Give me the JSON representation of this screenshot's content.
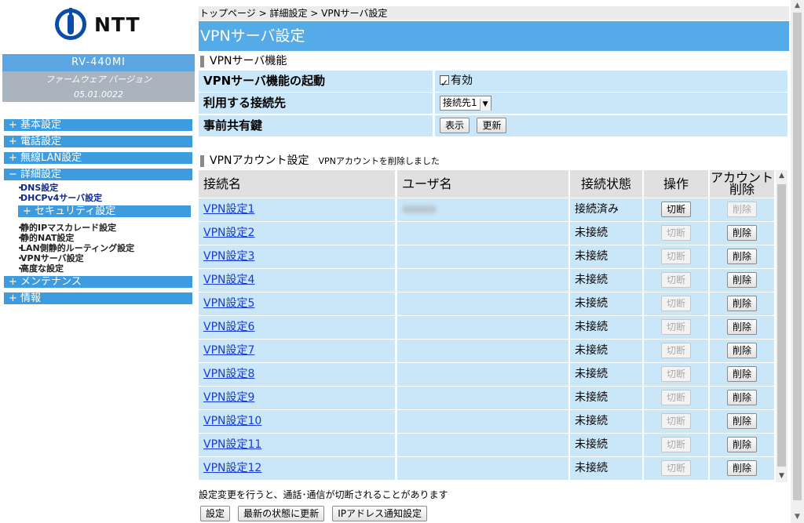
{
  "brand": {
    "logo_text": "NTT",
    "logo_icon": "ntt-logo-icon",
    "color": "#0a4da8"
  },
  "device": {
    "model": "RV-440MI",
    "firmware_label": "ファームウェア バージョン",
    "firmware_version": "05.01.0022"
  },
  "menu": {
    "basic": "+ 基本設定",
    "phone": "+ 電話設定",
    "wlan": "+ 無線LAN設定",
    "advanced": "− 詳細設定",
    "advanced_items": {
      "dns": "DNS設定",
      "dhcp": "DHCPv4サーバ設定",
      "security": "+ セキュリティ設定",
      "ipmasq": "静的IPマスカレード設定",
      "nat": "静的NAT設定",
      "routing": "LAN側静的ルーティング設定",
      "vpn": "VPNサーバ設定",
      "adv": "高度な設定"
    },
    "maintenance": "+ メンテナンス",
    "info": "+ 情報"
  },
  "breadcrumb": "トップページ > 詳細設定 > VPNサーバ設定",
  "page_title": "VPNサーバ設定",
  "vpn_server": {
    "heading": "VPNサーバ機能",
    "enable_label": "VPNサーバ機能の起動",
    "enable_value": "有効",
    "connection_label": "利用する接続先",
    "connection_value": "接続先1",
    "psk_label": "事前共有鍵",
    "show_button": "表示",
    "update_button": "更新"
  },
  "vpn_accounts": {
    "heading": "VPNアカウント設定",
    "message": "VPNアカウントを削除しました",
    "columns": {
      "name": "接続名",
      "user": "ユーザ名",
      "status": "接続状態",
      "action": "操作",
      "account_line1": "アカウント",
      "account_line2": "削除"
    },
    "disconnect_label": "切断",
    "delete_label": "削除",
    "rows": [
      {
        "name": "VPN設定1",
        "status": "接続済み"
      },
      {
        "name": "VPN設定2",
        "status": "未接続"
      },
      {
        "name": "VPN設定3",
        "status": "未接続"
      },
      {
        "name": "VPN設定4",
        "status": "未接続"
      },
      {
        "name": "VPN設定5",
        "status": "未接続"
      },
      {
        "name": "VPN設定6",
        "status": "未接続"
      },
      {
        "name": "VPN設定7",
        "status": "未接続"
      },
      {
        "name": "VPN設定8",
        "status": "未接続"
      },
      {
        "name": "VPN設定9",
        "status": "未接続"
      },
      {
        "name": "VPN設定10",
        "status": "未接続"
      },
      {
        "name": "VPN設定11",
        "status": "未接続"
      },
      {
        "name": "VPN設定12",
        "status": "未接続"
      }
    ]
  },
  "note": "設定変更を行うと、通話･通信が切断されることがあります",
  "buttons": {
    "save": "設定",
    "refresh": "最新の状態に更新",
    "ip_notify": "IPアドレス通知設定"
  },
  "colors": {
    "accent": "#55abe8",
    "row_bg": "#c9e7f9",
    "header_bg": "#e0e0e0",
    "link": "#1a3ad6"
  }
}
